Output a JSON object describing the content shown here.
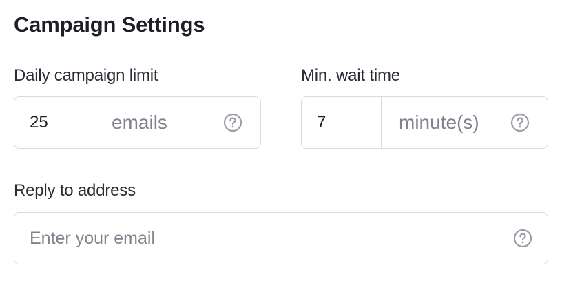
{
  "section": {
    "title": "Campaign Settings"
  },
  "daily_limit": {
    "label": "Daily campaign limit",
    "value": "25",
    "unit": "emails",
    "help_icon": "help-circle-icon"
  },
  "min_wait": {
    "label": "Min. wait time",
    "value": "7",
    "unit": "minute(s)",
    "help_icon": "help-circle-icon"
  },
  "reply_to": {
    "label": "Reply to address",
    "placeholder": "Enter your email",
    "value": "",
    "help_icon": "help-circle-icon"
  },
  "colors": {
    "border": "#d8dae0",
    "placeholder": "#80838e",
    "text": "#1d1f26",
    "icon": "#9a9ca6"
  }
}
